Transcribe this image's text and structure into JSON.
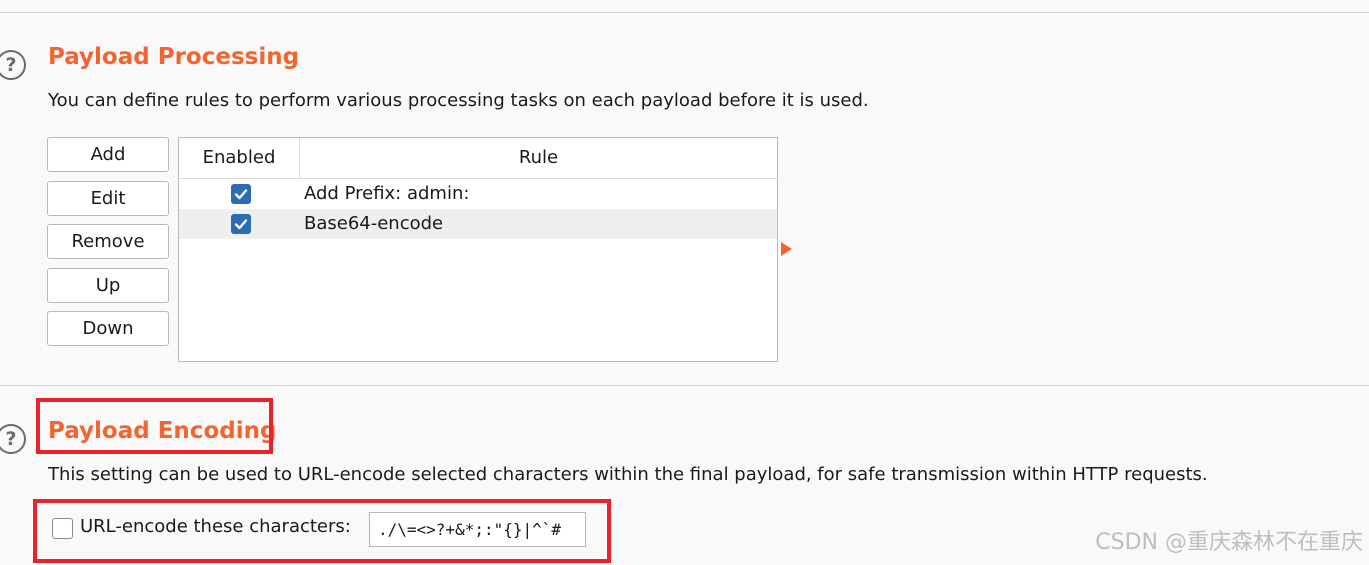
{
  "processing": {
    "title": "Payload Processing",
    "description": "You can define rules to perform various processing tasks on each payload before it is used.",
    "buttons": {
      "add": "Add",
      "edit": "Edit",
      "remove": "Remove",
      "up": "Up",
      "down": "Down"
    },
    "table": {
      "headers": {
        "enabled": "Enabled",
        "rule": "Rule"
      },
      "rows": [
        {
          "enabled": true,
          "rule": "Add Prefix: admin:"
        },
        {
          "enabled": true,
          "rule": "Base64-encode"
        }
      ]
    }
  },
  "encoding": {
    "title": "Payload Encoding",
    "description": "This setting can be used to URL-encode selected characters within the final payload, for safe transmission within HTTP requests.",
    "checkbox_label": "URL-encode these characters:",
    "checkbox_checked": false,
    "characters": "./\\=<>?+&*;:\"{}|^`#"
  },
  "icons": {
    "help": "help-icon",
    "expand": "triangle-right-icon",
    "check": "checkmark-icon"
  },
  "colors": {
    "accent": "#f26531",
    "checkbox": "#2c6cb5",
    "highlight": "#e8232b"
  },
  "watermark": "CSDN @重庆森林不在重庆"
}
